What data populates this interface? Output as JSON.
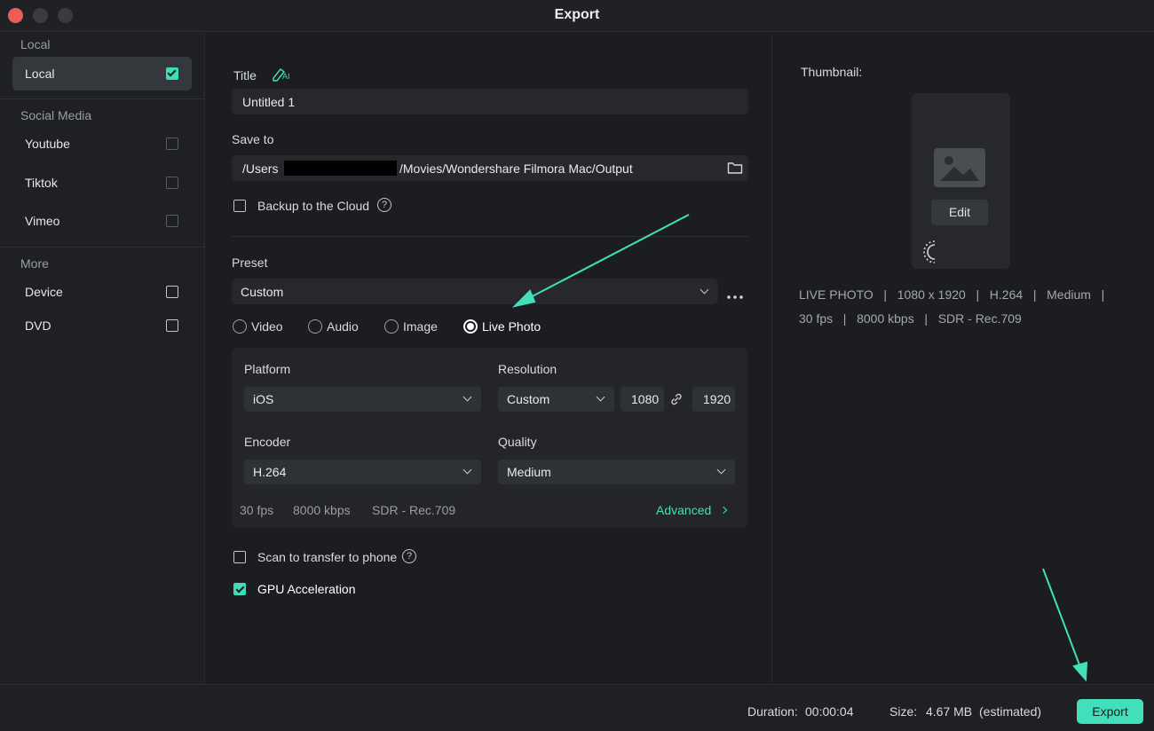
{
  "window": {
    "title": "Export"
  },
  "sidebar": {
    "sections": [
      {
        "label": "Local"
      },
      {
        "label": "Social Media"
      },
      {
        "label": "More"
      }
    ],
    "items": [
      {
        "label": "Local",
        "checked": true
      },
      {
        "label": "Youtube",
        "checked": false
      },
      {
        "label": "Tiktok",
        "checked": false
      },
      {
        "label": "Vimeo",
        "checked": false
      },
      {
        "label": "Device",
        "checked": false
      },
      {
        "label": "DVD",
        "checked": false
      }
    ]
  },
  "main": {
    "title_label": "Title",
    "title_ai_badge": "AI",
    "title_value": "Untitled 1",
    "save_label": "Save to",
    "save_path_prefix": "/Users",
    "save_path_suffix": "/Movies/Wondershare Filmora Mac/Output",
    "backup_label": "Backup to the Cloud",
    "preset_label": "Preset",
    "preset_value": "Custom",
    "formats": [
      {
        "label": "Video",
        "selected": false
      },
      {
        "label": "Audio",
        "selected": false
      },
      {
        "label": "Image",
        "selected": false
      },
      {
        "label": "Live Photo",
        "selected": true
      }
    ],
    "platform_label": "Platform",
    "platform_value": "iOS",
    "resolution_label": "Resolution",
    "resolution_mode": "Custom",
    "resolution_width": "1080",
    "resolution_height": "1920",
    "encoder_label": "Encoder",
    "encoder_value": "H.264",
    "quality_label": "Quality",
    "quality_value": "Medium",
    "info_fps": "30 fps",
    "info_bitrate": "8000 kbps",
    "info_color": "SDR - Rec.709",
    "advanced_label": "Advanced",
    "scan_label": "Scan to transfer to phone",
    "gpu_label": "GPU Acceleration",
    "gpu_checked": true
  },
  "right": {
    "thumbnail_label": "Thumbnail:",
    "edit_label": "Edit",
    "summary_line1": "LIVE PHOTO   |   1080 x 1920   |   H.264   |   Medium   |",
    "summary_line2": "30 fps   |   8000 kbps   |   SDR - Rec.709"
  },
  "footer": {
    "duration_label": "Duration:",
    "duration_value": "00:00:04",
    "size_label": "Size:",
    "size_value": "4.67 MB",
    "size_note": "(estimated)",
    "export_label": "Export"
  },
  "colors": {
    "accent": "#41e0bb",
    "background": "#1b1d20",
    "close": "#ef5b58"
  },
  "icons": [
    "folder-icon",
    "ai-pen-icon",
    "help-icon",
    "link-icon",
    "image-placeholder-icon",
    "live-photo-icon",
    "more-dots-icon",
    "chevron-down-icon",
    "chevron-right-icon"
  ]
}
